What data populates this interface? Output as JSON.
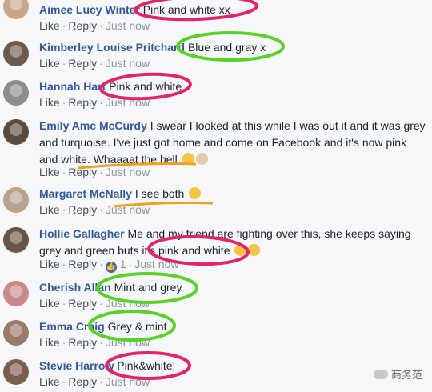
{
  "actions": {
    "like": "Like",
    "reply": "Reply",
    "sep": "·",
    "time": "Just now"
  },
  "comments": [
    {
      "author": "Aimee Lucy Winter",
      "text": "Pink and white xx",
      "emojis": [],
      "likes": ""
    },
    {
      "author": "Kimberley Louise Pritchard",
      "text": "Blue and gray x",
      "emojis": [],
      "likes": ""
    },
    {
      "author": "Hannah Hart",
      "text": "Pink and white",
      "emojis": [],
      "likes": ""
    },
    {
      "author": "Emily Amc McCurdy",
      "text": "I swear I looked at this while I was out it and it was grey and turquoise. I've just got home and come on Facebook and it's now pink and white. Whaaaat the hell",
      "emojis": [
        "weary-face",
        "person-shrugging"
      ],
      "likes": ""
    },
    {
      "author": "Margaret McNally",
      "text": "I see both",
      "emojis": [
        "grinning-face"
      ],
      "likes": ""
    },
    {
      "author": "Hollie Gallagher",
      "text": "Me and my friend are fighting over this, she keeps saying grey and green buts it's pink and white",
      "emojis": [
        "crying-face",
        "crying-face"
      ],
      "likes": "1"
    },
    {
      "author": "Cherish Allan",
      "text": "Mint and grey",
      "emojis": [],
      "likes": ""
    },
    {
      "author": "Emma Craig",
      "text": "Grey & mint",
      "emojis": [],
      "likes": ""
    },
    {
      "author": "Stevie Harrow",
      "text": "Pink&white!",
      "emojis": [],
      "likes": ""
    }
  ],
  "watermark": {
    "label": "商务范"
  },
  "colors": {
    "link": "#365899",
    "pink_mark": "#e0256a",
    "green_mark": "#59d12a",
    "orange_mark": "#f0a020",
    "like_blue": "#4267b2"
  }
}
